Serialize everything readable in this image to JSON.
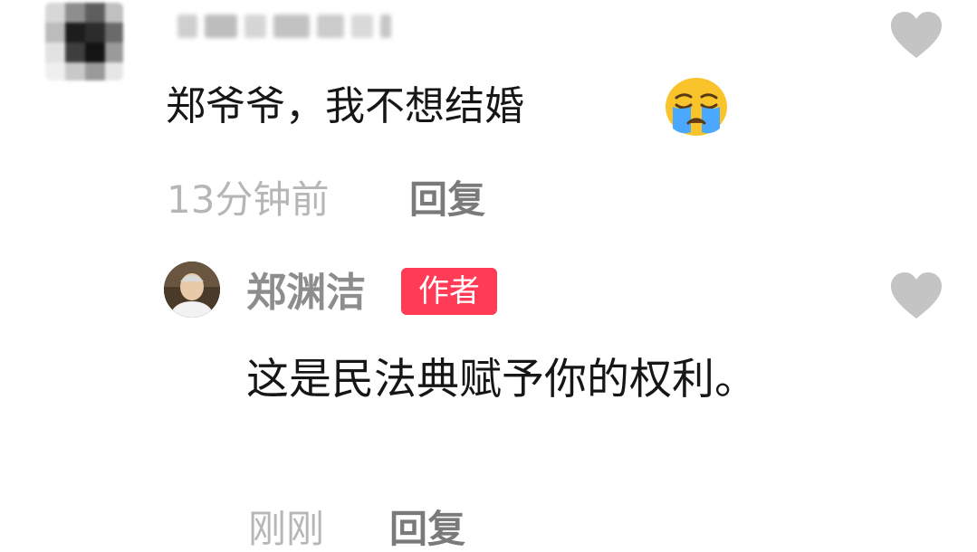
{
  "colors": {
    "background": "#ffffff",
    "text": "#161616",
    "meta_gray": "#b6b6b6",
    "reply_gray": "#7a7a7a",
    "author_gray": "#8d8d8d",
    "badge_red": "#ff3b55",
    "heart_gray": "#c4c4c4"
  },
  "comment": {
    "text": "郑爷爷，我不想结婚",
    "emoji": "loudly-crying-face",
    "time": "13分钟前",
    "reply_label": "回复"
  },
  "reply": {
    "author": "郑渊洁",
    "badge": "作者",
    "text": "这是民法典赋予你的权利。",
    "time": "刚刚",
    "reply_label": "回复"
  }
}
